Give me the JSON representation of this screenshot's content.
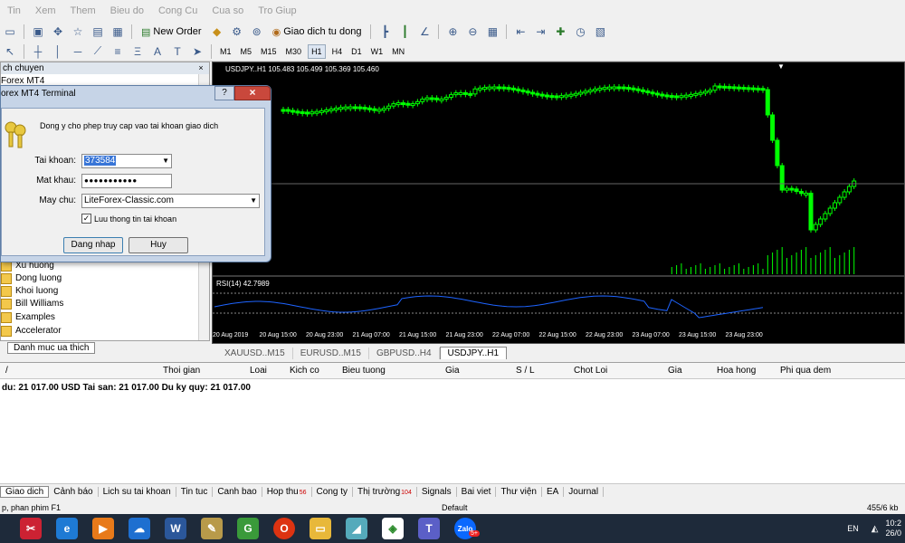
{
  "menubar": [
    "Tin",
    "Xem",
    "Them",
    "Bieu do",
    "Cong Cu",
    "Cua so",
    "Tro Giup"
  ],
  "toolbar": {
    "new_order": "New Order",
    "autotrade": "Giao dich tu dong",
    "timeframes": [
      "M1",
      "M5",
      "M15",
      "M30",
      "H1",
      "H4",
      "D1",
      "W1",
      "MN"
    ],
    "active_timeframe": "H1"
  },
  "navigator": {
    "title": "ch chuyen",
    "top_item": "Forex MT4",
    "items": [
      "Xu huong",
      "Dong luong",
      "Khoi luong",
      "Bill Williams",
      "Examples",
      "Accelerator"
    ],
    "tabs": [
      "Danh muc ua thich"
    ]
  },
  "chart": {
    "header": "USDJPY..H1  105.483 105.499 105.369 105.460",
    "rsi_label": "RSI(14) 42.7989",
    "time_labels": [
      "20 Aug 2019",
      "20 Aug 15:00",
      "20 Aug 23:00",
      "21 Aug 07:00",
      "21 Aug 15:00",
      "21 Aug 23:00",
      "22 Aug 07:00",
      "22 Aug 15:00",
      "22 Aug 23:00",
      "23 Aug 07:00",
      "23 Aug 15:00",
      "23 Aug 23:00"
    ],
    "tabs": [
      "XAUUSD..M15",
      "EURUSD..M15",
      "GBPUSD..H4",
      "USDJPY..H1"
    ],
    "active_tab": "USDJPY..H1"
  },
  "dialog": {
    "title": "orex MT4 Terminal",
    "help": "?",
    "close": "×",
    "message": "Dong y cho phep truy cap vao tai khoan giao dich",
    "account_label": "Tai khoan:",
    "account_value": "373584",
    "password_label": "Mat khau:",
    "password_value": "●●●●●●●●●●●",
    "server_label": "May chu:",
    "server_value": "LiteForex-Classic.com",
    "remember_label": "Luu thong tin tai khoan",
    "remember_checked": true,
    "login_button": "Dang nhap",
    "cancel_button": "Huy"
  },
  "terminal": {
    "columns": [
      "/",
      "Thoi gian",
      "Loai",
      "Kich co",
      "Bieu tuong",
      "Gia",
      "S / L",
      "Chot Loi",
      "Gia",
      "Hoa hong",
      "Phi qua dem"
    ],
    "balance": "du: 21 017.00 USD  Tai san: 21 017.00  Du ky quy: 21 017.00",
    "tabs": [
      "Giao dich",
      "Cảnh báo",
      "Lich su tai khoan",
      "Tin tuc",
      "Canh bao",
      "Hop thu",
      "Cong ty",
      "Thị trường",
      "Signals",
      "Bai viet",
      "Thư viện",
      "EA",
      "Journal"
    ],
    "badges": {
      "hop_thu": "56",
      "thi_truong": "104"
    },
    "active_tab": "Giao dich"
  },
  "statusbar": {
    "left": "p, phan phim F1",
    "middle": "Default",
    "right": "455/6 kb"
  },
  "taskbar": {
    "icons": [
      "snipping-tool",
      "internet-explorer",
      "media-player",
      "onedrive",
      "word",
      "paint",
      "garena",
      "opera",
      "file-explorer",
      "notes",
      "liteforex",
      "teams",
      "zalo"
    ],
    "zalo_badge": "5+",
    "lang": "EN",
    "time": "10:2",
    "date": "26/0"
  },
  "colors": {
    "candle_up": "#00ff00",
    "candle_down": "#00ff00",
    "rsi_line": "#1e64ff",
    "chart_bg": "#000000"
  }
}
